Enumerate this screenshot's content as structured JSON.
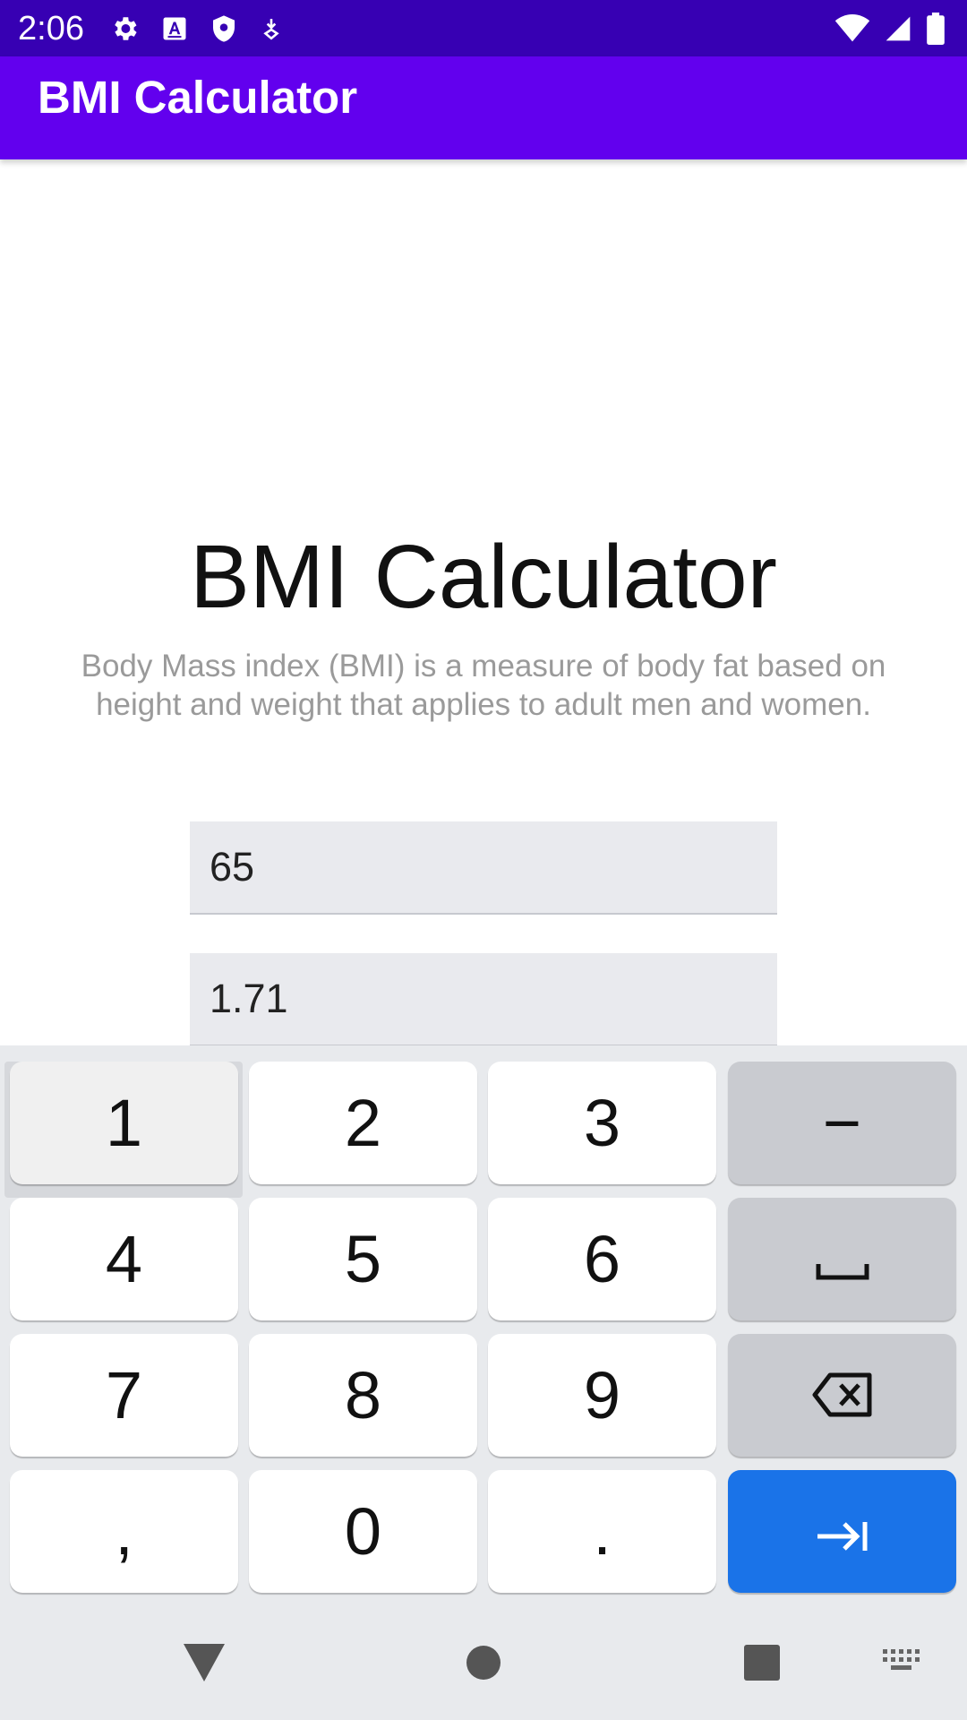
{
  "status_bar": {
    "time": "2:06",
    "icons_left": [
      "settings-icon",
      "text-a-icon",
      "shield-icon",
      "download-icon"
    ],
    "icons_right": [
      "wifi-icon",
      "signal-icon",
      "battery-icon"
    ]
  },
  "app_bar": {
    "title": "BMI Calculator"
  },
  "main": {
    "heading": "BMI Calculator",
    "description": "Body Mass index (BMI) is a measure of body fat based on height and weight that applies to adult men and women.",
    "weight_value": "65",
    "height_value": "1.71"
  },
  "keyboard": {
    "keys": [
      {
        "label": "1"
      },
      {
        "label": "2"
      },
      {
        "label": "3"
      },
      {
        "label": "−"
      },
      {
        "label": "4"
      },
      {
        "label": "5"
      },
      {
        "label": "6"
      },
      {
        "label": "space-icon"
      },
      {
        "label": "7"
      },
      {
        "label": "8"
      },
      {
        "label": "9"
      },
      {
        "label": "backspace-icon"
      },
      {
        "label": ","
      },
      {
        "label": "0"
      },
      {
        "label": "."
      },
      {
        "label": "next-arrow-icon"
      }
    ]
  },
  "nav_bar": {
    "icons": [
      "back-icon",
      "home-icon",
      "recents-icon",
      "keyboard-icon"
    ]
  },
  "colors": {
    "status_bar": "#3700b3",
    "app_bar": "#6200ee",
    "action_key": "#1a73e8",
    "function_key": "#c9cbd0"
  }
}
